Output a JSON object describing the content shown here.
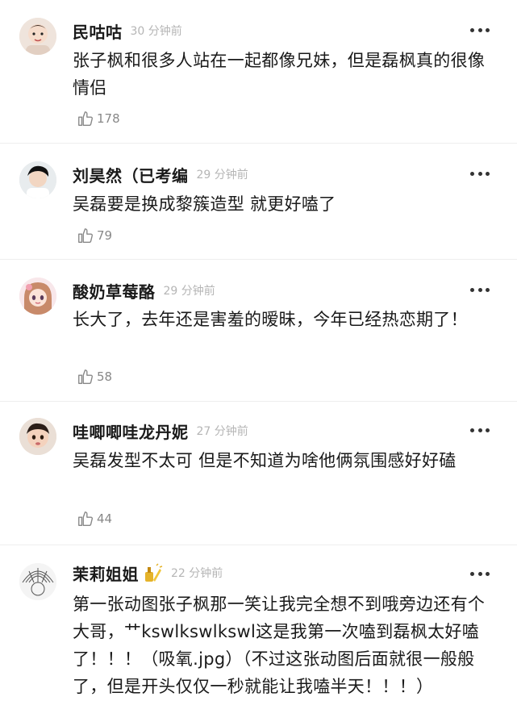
{
  "comments": [
    {
      "username": "民咕咕",
      "time": "30 分钟前",
      "text": "张子枫和很多人站在一起都像兄妹，但是磊枫真的很像情侣",
      "likes": "178",
      "avatar_icon": "baby-photo-avatar"
    },
    {
      "username": "刘昊然（已考编",
      "time": "29 分钟前",
      "text": "吴磊要是换成黎簇造型 就更好嗑了",
      "likes": "79",
      "avatar_icon": "actor-photo-avatar"
    },
    {
      "username": "酸奶草莓酪",
      "time": "29 分钟前",
      "text": "长大了，去年还是害羞的暧昧，今年已经热恋期了！",
      "likes": "58",
      "avatar_icon": "anime-girl-avatar"
    },
    {
      "username": "哇唧唧哇龙丹妮",
      "time": "27 分钟前",
      "text": "吴磊发型不太可 但是不知道为啥他俩氛围感好好磕",
      "likes": "44",
      "avatar_icon": "child-photo-avatar"
    },
    {
      "username": "茉莉姐姐",
      "time": "22 分钟前",
      "text": "第一张动图张子枫那一笑让我完全想不到哦旁边还有个大哥，艹kswlkswlkswl这是我第一次嗑到磊枫太好嗑了！！！（吸氧.jpg）（不过这张动图后面就很一般般了，但是开头仅仅一秒就能让我嗑半天！！！）",
      "likes": "",
      "avatar_icon": "sketch-avatar",
      "sticker_icon": "nail-polish-sticker-icon"
    }
  ],
  "colors": {
    "text": "#1a1a1a",
    "muted": "#b5b5b5",
    "likes": "#888888",
    "divider": "#eeeeee"
  }
}
